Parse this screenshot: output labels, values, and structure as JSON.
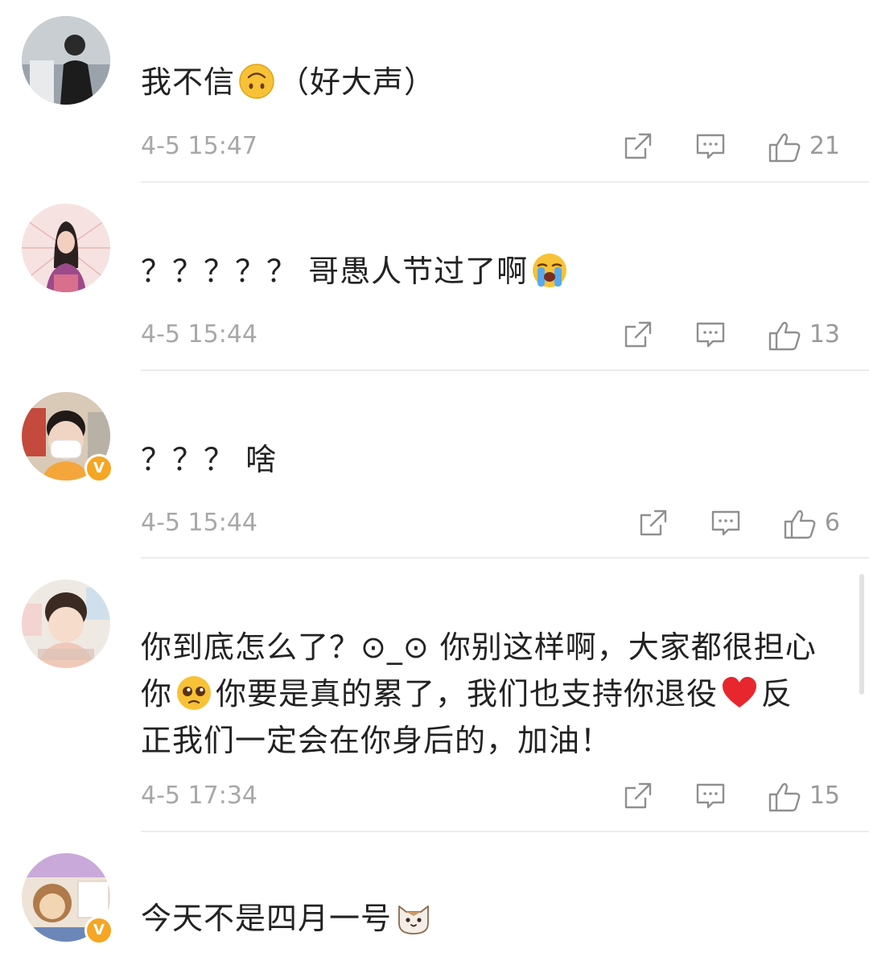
{
  "comments": [
    {
      "text_parts": [
        "我不信",
        "（好大声）"
      ],
      "emoji": "upside-down-face",
      "time": "4-5 15:47",
      "likes": "21"
    },
    {
      "text_parts": [
        "？？？？？ 哥愚人节过了啊"
      ],
      "emoji": "loudly-crying-face",
      "time": "4-5 15:44",
      "likes": "13"
    },
    {
      "text_parts": [
        "？？？ 啥"
      ],
      "time": "4-5 15:44",
      "likes": "6",
      "verified": "V"
    },
    {
      "text_line1": "你到底怎么了？⊙_⊙ 你别这样啊，大家都很担心",
      "text_line2a": "你",
      "text_line2b": "你要是真的累了，我们也支持你退役",
      "text_line2c": "反",
      "text_line3": "正我们一定会在你身后的，加油！",
      "emoji_1": "pleading-face",
      "emoji_2": "red-heart",
      "time": "4-5 17:34",
      "likes": "15"
    },
    {
      "text_parts": [
        "今天不是四月一号"
      ],
      "emoji": "cat-face",
      "verified": "V"
    }
  ],
  "icons": {
    "share": "share-icon",
    "comment": "comment-icon",
    "like": "thumbs-up-icon"
  },
  "colors": {
    "text": "#222222",
    "meta": "#a8a8a8",
    "verified_badge": "#f5a623",
    "divider": "#ececec"
  }
}
